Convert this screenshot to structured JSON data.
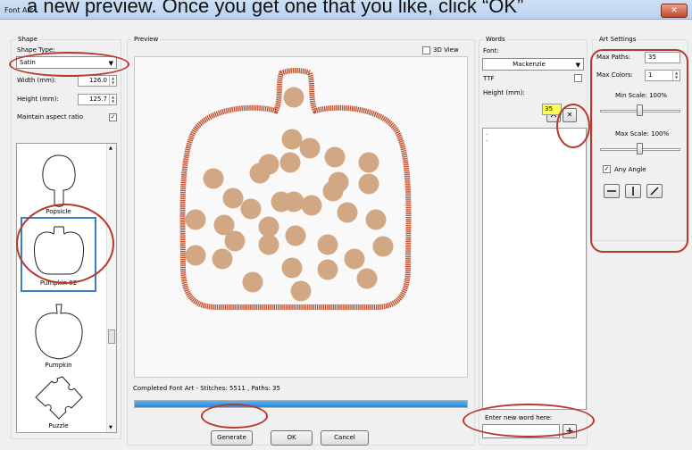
{
  "caption": "a new preview.  Once you get one that you like, click “OK”",
  "window": {
    "title": "Font Art",
    "close_icon": "close-icon"
  },
  "shape": {
    "group_label": "Shape",
    "type_label": "Shape Type:",
    "type_value": "Satin",
    "width_label": "Width (mm):",
    "width_value": "126.0",
    "height_label": "Height (mm):",
    "height_value": "125.7",
    "aspect_label": "Maintain aspect ratio",
    "aspect_checked": "✓",
    "items": [
      {
        "label": "Popsicle",
        "icon": "popsicle-shape-icon"
      },
      {
        "label": "Pumpkin 02",
        "icon": "pumpkin-02-shape-icon"
      },
      {
        "label": "Pumpkin",
        "icon": "pumpkin-shape-icon"
      },
      {
        "label": "Puzzle",
        "icon": "puzzle-shape-icon"
      }
    ]
  },
  "preview": {
    "group_label": "Preview",
    "view3d_label": "3D View",
    "status": "Completed Font Art - Stitches: 5511 , Paths: 35",
    "progress_percent": 100,
    "outline_color": "#c1502e",
    "fill_color": "#d2a784"
  },
  "buttons": {
    "generate": "Generate",
    "ok": "OK",
    "cancel": "Cancel"
  },
  "words": {
    "group_label": "Words",
    "font_label": "Font:",
    "font_value": "Mackenzie",
    "ttf_label": "TTF",
    "height_label": "Height (mm):",
    "height_value": "35",
    "list_lines": [
      ".",
      "."
    ],
    "new_word_label": "Enter new word here:",
    "new_word_value": "",
    "add_symbol": "+",
    "delete_symbol": "✕",
    "clear_symbol": "✕"
  },
  "art": {
    "group_label": "Art Settings",
    "max_paths_label": "Max Paths:",
    "max_paths_value": "35",
    "max_colors_label": "Max Colors:",
    "max_colors_value": "1",
    "min_scale_label": "Min Scale: 100%",
    "max_scale_label": "Max Scale: 100%",
    "any_angle_label": "Any Angle",
    "any_angle_checked": "✓"
  },
  "accent_color": "#b8392a"
}
